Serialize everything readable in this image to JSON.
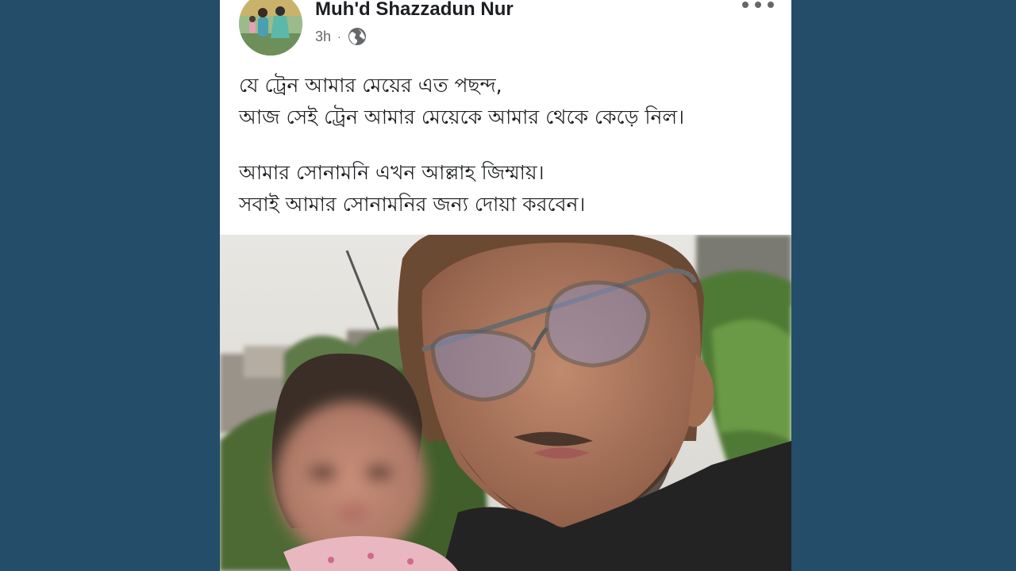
{
  "post": {
    "author_name": "Muh'd Shazzadun Nur",
    "timestamp": "3h",
    "separator": "·",
    "privacy_icon": "globe-icon",
    "more_icon": "more-horizontal-icon",
    "text_lines": [
      "যে ট্রেন আমার মেয়ের এত পছন্দ,",
      "আজ সেই ট্রেন আমার মেয়েকে আমার থেকে কেড়ে নিল।",
      "আমার সোনামনি এখন আল্লাহ জিম্মায়।",
      "সবাই আমার সোনামনির জন্য দোয়া করবেন।"
    ]
  },
  "colors": {
    "page_background": "#244d69",
    "card_background": "#ffffff",
    "name_text": "#1c1e21",
    "secondary_text": "#65676b"
  }
}
